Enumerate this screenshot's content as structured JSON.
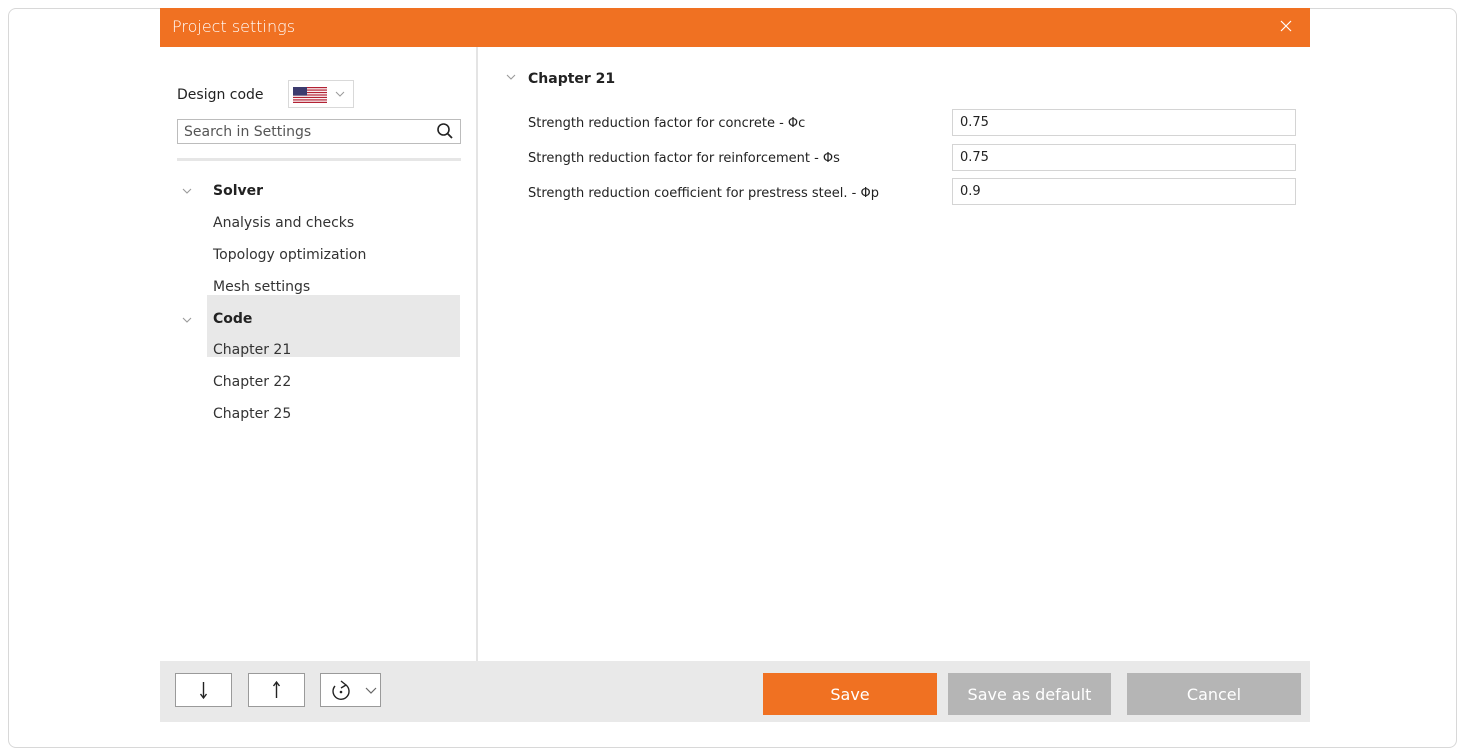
{
  "dialog": {
    "title": "Project settings"
  },
  "left": {
    "design_code_label": "Design code",
    "search_placeholder": "Search in Settings",
    "tree": {
      "solver_label": "Solver",
      "solver_items": [
        "Analysis and checks",
        "Topology optimization",
        "Mesh settings"
      ],
      "code_label": "Code",
      "code_items": [
        "Chapter 21",
        "Chapter 22",
        "Chapter 25"
      ],
      "selected_item": "Chapter 21"
    }
  },
  "main": {
    "section_title": "Chapter 21",
    "properties": [
      {
        "label": "Strength reduction factor for concrete - Φc",
        "value": "0.75"
      },
      {
        "label": "Strength reduction factor for reinforcement - Φs",
        "value": "0.75"
      },
      {
        "label": "Strength reduction coefficient for prestress steel. - Φp",
        "value": "0.9"
      }
    ]
  },
  "footer": {
    "save_label": "Save",
    "save_default_label": "Save as default",
    "cancel_label": "Cancel"
  },
  "colors": {
    "accent": "#f07122",
    "disabled_button": "#b5b5b5",
    "footer_bg": "#e9e9e9"
  }
}
